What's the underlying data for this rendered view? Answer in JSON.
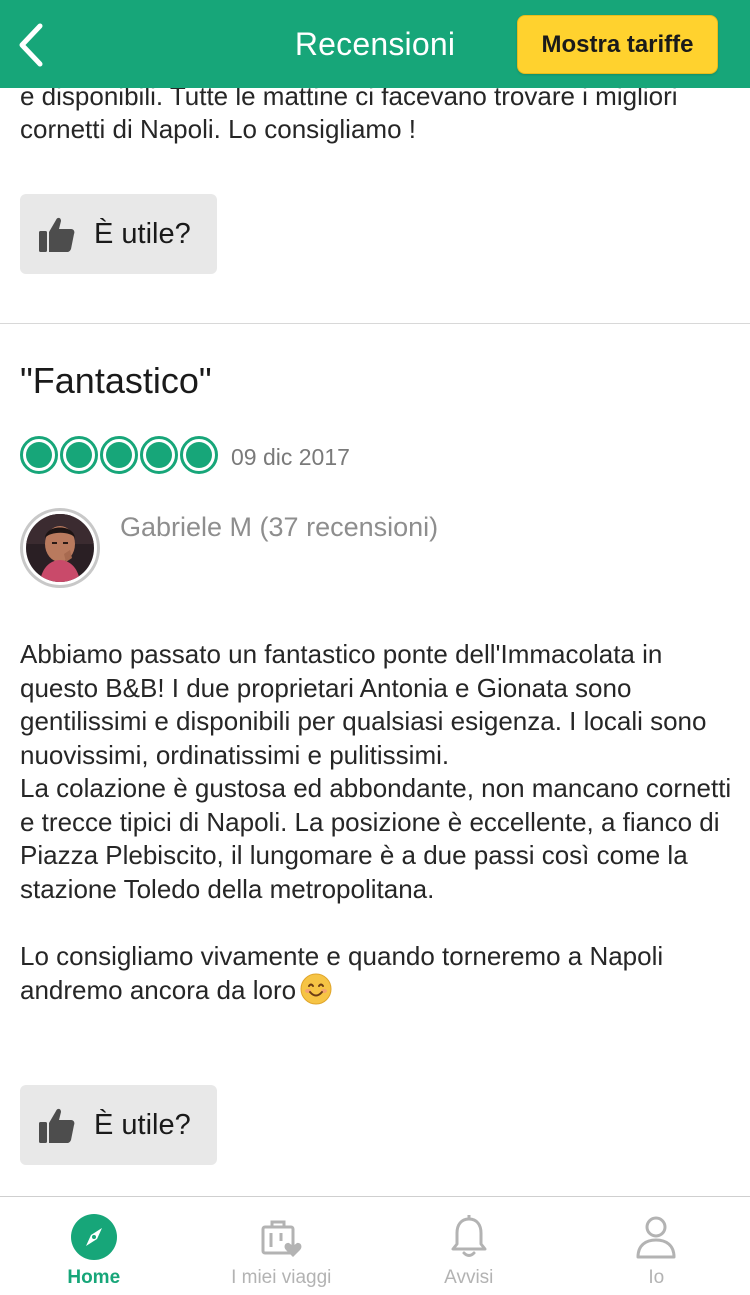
{
  "header": {
    "title": "Recensioni",
    "rates_button": "Mostra tariffe",
    "back_icon": "chevron-left-icon",
    "bg_color": "#17a679",
    "button_color": "#ffd22e"
  },
  "previous_review": {
    "text_tail": "e disponibili. Tutte le mattine ci facevano trovare i migliori cornetti di Napoli. Lo consigliamo !",
    "helpful_label": "È utile?"
  },
  "review": {
    "title": "\"Fantastico\"",
    "rating": 5,
    "rating_max": 5,
    "date": "09 dic 2017",
    "reviewer": "Gabriele M (37 recensioni)",
    "body_lines": [
      "Abbiamo passato un fantastico ponte dell'Immacolata in questo B&B! I due proprietari Antonia e Gionata sono gentilissimi e disponibili per qualsiasi esigenza. I locali sono nuovissimi, ordinatissimi e pulitissimi.",
      "La colazione è gustosa ed abbondante, non mancano cornetti e trecce tipici di Napoli. La posizione è eccellente, a fianco di Piazza Plebiscito, il lungomare è a due passi così come la stazione Toledo della metropolitana."
    ],
    "body_closing": "Lo consigliamo vivamente e quando torneremo a Napoli andremo ancora da loro",
    "emoji_icon": "smiling-face-icon",
    "helpful_label": "È utile?"
  },
  "tabbar": {
    "items": [
      {
        "label": "Home",
        "icon": "compass-icon",
        "active": true
      },
      {
        "label": "I miei viaggi",
        "icon": "suitcase-heart-icon",
        "active": false
      },
      {
        "label": "Avvisi",
        "icon": "bell-icon",
        "active": false
      },
      {
        "label": "Io",
        "icon": "user-icon",
        "active": false
      }
    ]
  }
}
